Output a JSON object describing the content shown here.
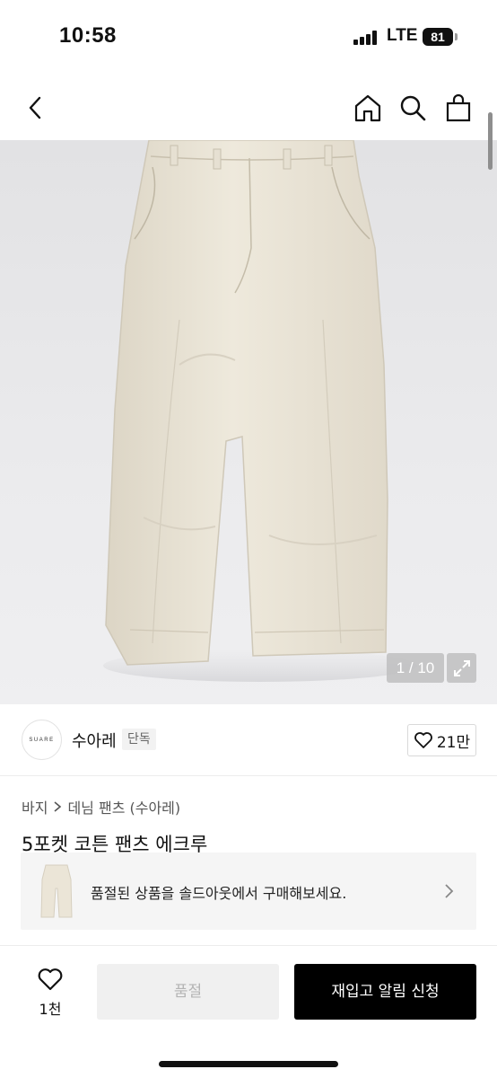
{
  "status_bar": {
    "time": "10:58",
    "network": "LTE",
    "battery": "81"
  },
  "header": {
    "back_icon": "chevron-left-icon",
    "home_icon": "home-icon",
    "search_icon": "search-icon",
    "cart_icon": "shopping-bag-icon"
  },
  "gallery": {
    "counter": "1 / 10",
    "expand_icon": "expand-icon"
  },
  "brand": {
    "logo_text": "SUARE",
    "name": "수아레",
    "badge": "단독",
    "likes": "21만"
  },
  "product": {
    "breadcrumb": [
      "바지",
      "데님 팬츠 (수아레)"
    ],
    "title": "5포켓 코튼 팬츠 에크루"
  },
  "soldout_banner": {
    "text": "품절된 상품을 솔드아웃에서 구매해보세요."
  },
  "bottom_bar": {
    "like_count": "1천",
    "soldout_label": "품절",
    "restock_label": "재입고 알림 신청"
  },
  "colors": {
    "accent": "#000000",
    "product": "#ece6d8"
  }
}
